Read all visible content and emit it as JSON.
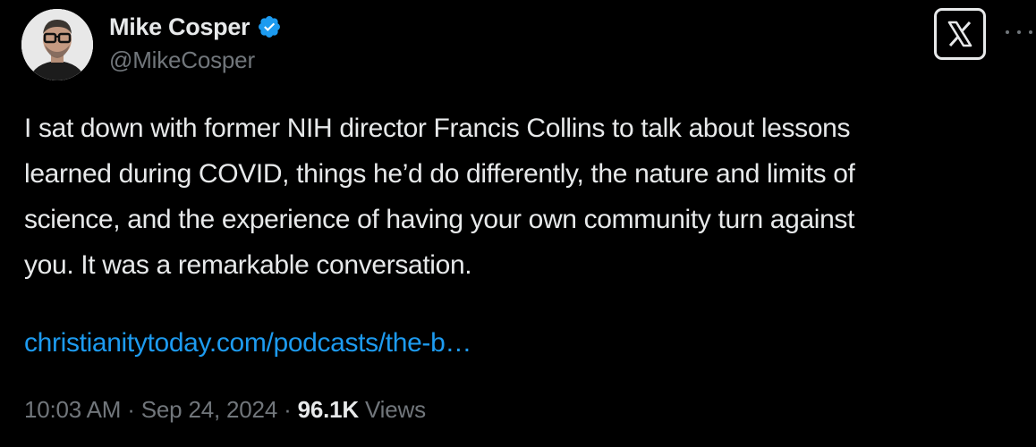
{
  "author": {
    "display_name": "Mike Cosper",
    "handle": "@MikeCosper",
    "verified": true,
    "verified_badge_color": "#1d9bf0"
  },
  "tweet": {
    "text_lines": [
      "I sat down with former NIH director Francis Collins to talk about lessons",
      "learned during COVID, things he’d do differently, the nature and limits of",
      "science, and the experience of having your own community turn against",
      "you. It was a remarkable conversation."
    ],
    "link_text": "christianitytoday.com/podcasts/the-b…",
    "link_color": "#1d9bf0"
  },
  "meta": {
    "time": "10:03 AM",
    "separator": " · ",
    "date": "Sep 24, 2024",
    "views_count": "96.1K",
    "views_label": " Views"
  },
  "icons": {
    "verified": "verified-badge-icon",
    "x_logo": "x-logo-icon",
    "more": "more-options-icon"
  },
  "colors": {
    "background": "#000000",
    "primary_text": "#e7e9ea",
    "secondary_text": "#71767b",
    "accent": "#1d9bf0"
  }
}
